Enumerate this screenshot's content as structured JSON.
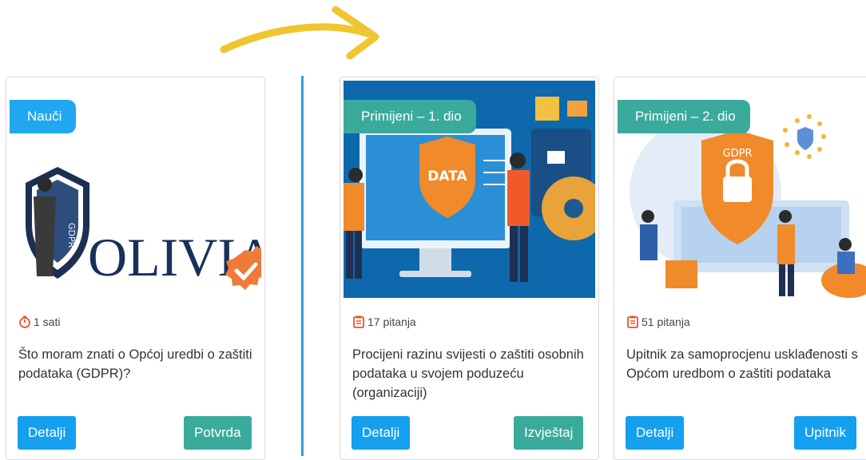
{
  "cards": [
    {
      "badge": "Nauči",
      "badge_color": "#20a7ef",
      "logo_text": "OLIVIA",
      "logo_shield_text": "GDPR",
      "meta": "1 sati",
      "meta_icon": "stopwatch-icon",
      "title": "Što moram znati o Općoj uredbi o zaštiti podataka (GDPR)?",
      "details_label": "Detalji",
      "action_label": "Potvrda"
    },
    {
      "badge": "Primijeni – 1. dio",
      "badge_color": "#3aaa9d",
      "illustration_text": "DATA",
      "meta": "17 pitanja",
      "meta_icon": "clipboard-icon",
      "title": "Procijeni razinu svijesti o zaštiti osobnih podataka u svojem poduzeću (organizaciji)",
      "details_label": "Detalji",
      "action_label": "Izvještaj"
    },
    {
      "badge": "Primijeni – 2. dio",
      "badge_color": "#3aaa9d",
      "illustration_text": "GDPR",
      "meta": "51 pitanja",
      "meta_icon": "clipboard-icon",
      "title": "Upitnik za samoprocjenu usklađenosti s Općom uredbom o zaštiti podataka",
      "details_label": "Detalji",
      "action_label": "Upitnik"
    }
  ],
  "colors": {
    "primary_button": "#14a0ef",
    "secondary_button": "#3aaa9d",
    "divider": "#2aa3e0",
    "arrow": "#f0c530"
  }
}
